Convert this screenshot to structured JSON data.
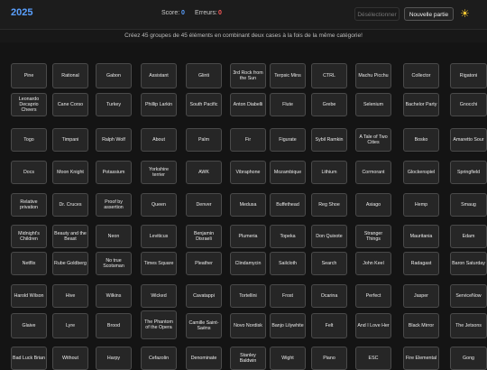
{
  "header": {
    "title": "2025",
    "score_label": "Score:",
    "score_value": "0",
    "errors_label": "Erreurs:",
    "errors_value": "0",
    "deselect_label": "Désélectionner",
    "new_game_label": "Nouvelle partie",
    "theme_icon": "sun-icon"
  },
  "instructions": "Créez 45 groupes de 45 éléments en combinant deux cases à la fois de la même catégorie!",
  "rows": [
    [
      "Pine",
      "Rational",
      "Gabon",
      "Assistant",
      "Glinti",
      "3rd Rock from the Sun",
      "Terpsic Mins",
      "CTRL",
      "Machu Picchu",
      "Collector",
      "Rigatoni"
    ],
    [
      "Leonardo Decaprio Cheers",
      "Cane Corso",
      "Turkey",
      "Phillip Larkin",
      "South Pacific",
      "Anton Diabelli",
      "Flute",
      "Grebe",
      "Selenium",
      "Bachelor Party",
      "Gnocchi"
    ],
    [
      "Togo",
      "Timpani",
      "Ralph Wolf",
      "About",
      "Palm",
      "Fir",
      "Figurate",
      "Sybil Ramkin",
      "A Tale of Two Cities",
      "Bosko",
      "Amaretto Sour"
    ],
    [
      "Docs",
      "Moon Knight",
      "Potassium",
      "Yorkshire terrier",
      "AWK",
      "Vibraphone",
      "Mozambique",
      "Lithium",
      "Cormorant",
      "Glockenspiel",
      "Springfield"
    ],
    [
      "Relative privation",
      "Dr. Cruces",
      "Proof by assertion",
      "Queen",
      "Denver",
      "Medusa",
      "Buffethead",
      "Reg Shoe",
      "Asiago",
      "Hemp",
      "Smaug"
    ],
    [
      "Midnight's Children",
      "Beauty and the Beast",
      "Neon",
      "Leviticus",
      "Benjamin Disraeli",
      "Plumeria",
      "Topeka",
      "Don Quixote",
      "Stranger Things",
      "Mauritania",
      "Edam"
    ],
    [
      "Netflix",
      "Rube Goldberg",
      "No true Scotsman",
      "Times Square",
      "Pleather",
      "Clindamycin",
      "Sailcloth",
      "Search",
      "John Keel",
      "Radagast",
      "Baron Saturday"
    ],
    [
      "Harold Wilson",
      "Hive",
      "Wilkins",
      "Wicked",
      "Cavatappi",
      "Tortellini",
      "Frost",
      "Ocarina",
      "Perfect",
      "Jasper",
      "ServiceNow"
    ],
    [
      "Glaive",
      "Lyre",
      "Brood",
      "The Phantom of the Opera",
      "Camille Saint-Saëns",
      "Novo Nordisk",
      "Banjo Lilywhite",
      "Felt",
      "And I Love Her",
      "Black Mirror",
      "The Jetsons"
    ],
    [
      "Bad Luck Brian",
      "Without",
      "Harpy",
      "Cefazolin",
      "Denominate",
      "Stanley Baldwin",
      "Wight",
      "Piano",
      "ESC",
      "Fire Elemental",
      "Gong"
    ]
  ]
}
